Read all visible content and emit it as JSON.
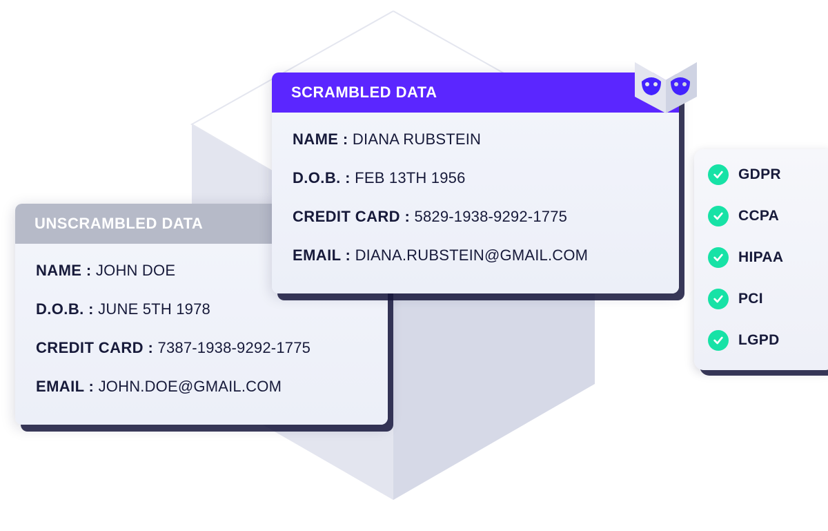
{
  "unscrambled": {
    "title": "UNSCRAMBLED DATA",
    "fields": {
      "name_k": "NAME :",
      "name_v": " JOHN DOE",
      "dob_k": "D.O.B. :",
      "dob_v": " JUNE 5TH 1978",
      "cc_k": "CREDIT CARD :",
      "cc_v": " 7387-1938-9292-1775",
      "email_k": "EMAIL :",
      "email_v": " JOHN.DOE@GMAIL.COM"
    }
  },
  "scrambled": {
    "title": "SCRAMBLED DATA",
    "fields": {
      "name_k": "NAME :",
      "name_v": " DIANA RUBSTEIN",
      "dob_k": "D.O.B. :",
      "dob_v": " FEB 13TH 1956",
      "cc_k": "CREDIT CARD :",
      "cc_v": " 5829-1938-9292-1775",
      "email_k": "EMAIL :",
      "email_v": " DIANA.RUBSTEIN@GMAIL.COM"
    }
  },
  "compliance": {
    "items": [
      {
        "label": "GDPR"
      },
      {
        "label": "CCPA"
      },
      {
        "label": "HIPAA"
      },
      {
        "label": "PCI"
      },
      {
        "label": "LGPD"
      }
    ]
  },
  "colors": {
    "purple": "#5b26ff",
    "grey": "#b6bac8",
    "mint": "#17e2a6",
    "ink": "#171a3a"
  }
}
